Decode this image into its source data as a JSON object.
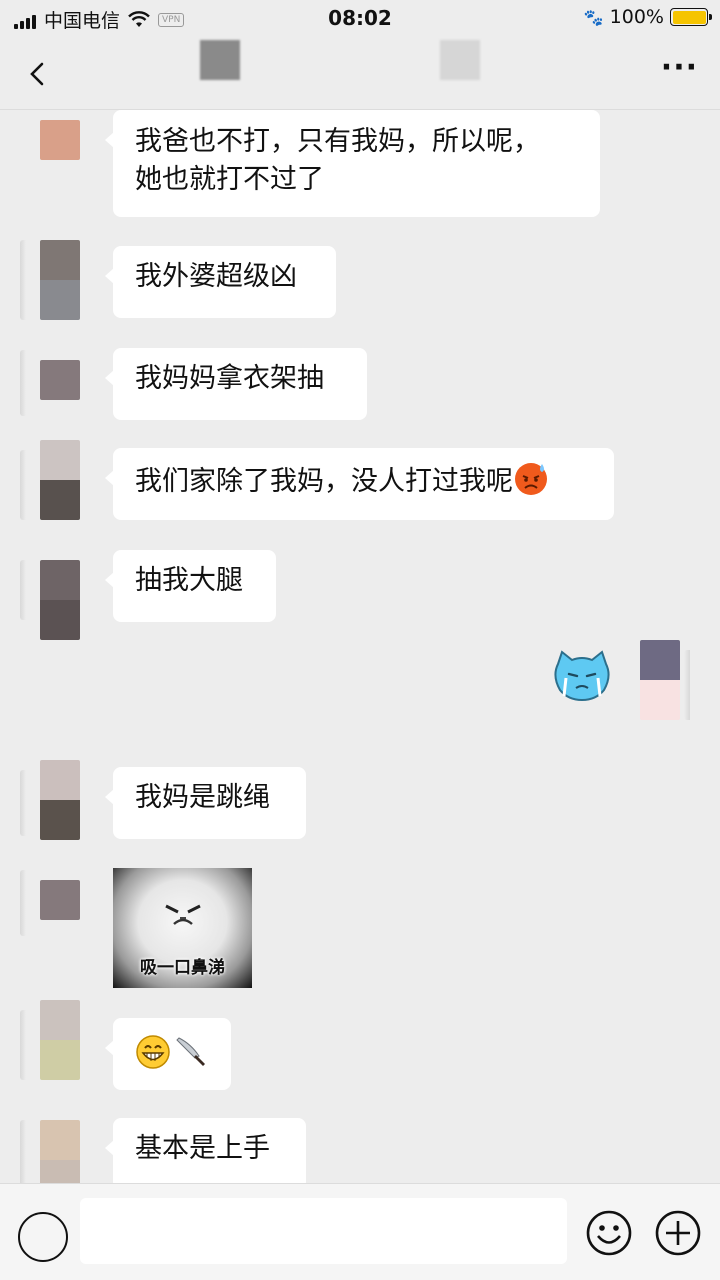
{
  "status_bar": {
    "carrier": "中国电信",
    "vpn": "VPN",
    "time": "08:02",
    "battery": "100%",
    "battery_color": "#f5c400"
  },
  "nav": {
    "back_icon": "chevron-left-icon",
    "more_icon": "more-dots-icon",
    "more_label": "···"
  },
  "messages": [
    {
      "side": "left",
      "type": "text",
      "lines": [
        "我爸也不打，只有我妈，所以呢，",
        "她也就打不过了"
      ]
    },
    {
      "side": "left",
      "type": "text",
      "text": "我外婆超级凶"
    },
    {
      "side": "left",
      "type": "text",
      "text": "我妈妈拿衣架抽"
    },
    {
      "side": "left",
      "type": "text",
      "text": "我们家除了我妈，没人打过我呢",
      "emoji": "angry-sweat-emoji"
    },
    {
      "side": "left",
      "type": "text",
      "text": "抽我大腿"
    },
    {
      "side": "right",
      "type": "sticker",
      "sticker": "crying-blue-cat-sticker"
    },
    {
      "side": "left",
      "type": "text",
      "text": "我妈是跳绳"
    },
    {
      "side": "left",
      "type": "image",
      "caption": "吸一口鼻涕"
    },
    {
      "side": "left",
      "type": "emoji",
      "emojis": [
        "grinning-face-emoji",
        "kitchen-knife-emoji"
      ]
    },
    {
      "side": "left",
      "type": "text",
      "text": "基本是上手"
    }
  ],
  "input_bar": {
    "voice_icon": "voice-icon",
    "emoji_icon": "smiley-icon",
    "plus_icon": "plus-icon",
    "text_value": ""
  },
  "colors": {
    "background": "#ededed",
    "bubble_left": "#ffffff"
  }
}
